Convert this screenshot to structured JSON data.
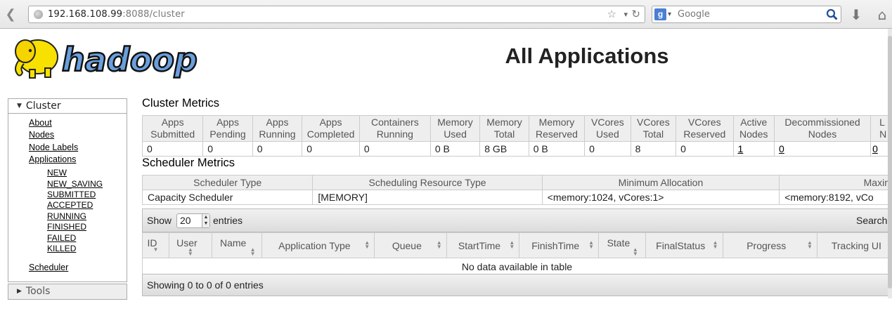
{
  "browser": {
    "url_host": "192.168.108.99",
    "url_path": ":8088/cluster",
    "search_placeholder": "Google",
    "search_engine_letter": "g"
  },
  "header": {
    "logo_text": "hadoop",
    "title": "All Applications"
  },
  "sidebar": {
    "cluster_label": "Cluster",
    "links": {
      "about": "About",
      "nodes": "Nodes",
      "node_labels": "Node Labels",
      "applications": "Applications",
      "scheduler": "Scheduler"
    },
    "app_states": {
      "new": "NEW",
      "new_saving": "NEW_SAVING",
      "submitted": "SUBMITTED",
      "accepted": "ACCEPTED",
      "running": "RUNNING",
      "finished": "FINISHED",
      "failed": "FAILED",
      "killed": "KILLED"
    },
    "tools_label": "Tools"
  },
  "cluster_metrics": {
    "title": "Cluster Metrics",
    "headers": {
      "apps_submitted": [
        "Apps",
        "Submitted"
      ],
      "apps_pending": [
        "Apps",
        "Pending"
      ],
      "apps_running": [
        "Apps",
        "Running"
      ],
      "apps_completed": [
        "Apps",
        "Completed"
      ],
      "containers_running": [
        "Containers",
        "Running"
      ],
      "memory_used": [
        "Memory",
        "Used"
      ],
      "memory_total": [
        "Memory",
        "Total"
      ],
      "memory_reserved": [
        "Memory",
        "Reserved"
      ],
      "vcores_used": [
        "VCores",
        "Used"
      ],
      "vcores_total": [
        "VCores",
        "Total"
      ],
      "vcores_reserved": [
        "VCores",
        "Reserved"
      ],
      "active_nodes": [
        "Active",
        "Nodes"
      ],
      "decommissioned_nodes": [
        "Decommissioned",
        "Nodes"
      ],
      "lost_nodes": [
        "L",
        "N"
      ]
    },
    "values": {
      "apps_submitted": "0",
      "apps_pending": "0",
      "apps_running": "0",
      "apps_completed": "0",
      "containers_running": "0",
      "memory_used": "0 B",
      "memory_total": "8 GB",
      "memory_reserved": "0 B",
      "vcores_used": "0",
      "vcores_total": "8",
      "vcores_reserved": "0",
      "active_nodes": "1",
      "decommissioned_nodes": "0",
      "lost_nodes": "0"
    }
  },
  "scheduler_metrics": {
    "title": "Scheduler Metrics",
    "headers": {
      "type": "Scheduler Type",
      "resource_type": "Scheduling Resource Type",
      "min_alloc": "Minimum Allocation",
      "max_alloc": "Maxin"
    },
    "values": {
      "type": "Capacity Scheduler",
      "resource_type": "[MEMORY]",
      "min_alloc": "<memory:1024, vCores:1>",
      "max_alloc": "<memory:8192, vCo"
    }
  },
  "apps_table": {
    "show_label": "Show",
    "page_size": "20",
    "entries_label": "entries",
    "search_label": "Search",
    "columns": {
      "id": "ID",
      "user": "User",
      "name": "Name",
      "app_type": "Application Type",
      "queue": "Queue",
      "start_time": "StartTime",
      "finish_time": "FinishTime",
      "state": "State",
      "final_status": "FinalStatus",
      "progress": "Progress",
      "tracking_ui": "Tracking UI"
    },
    "empty_message": "No data available in table",
    "info": "Showing 0 to 0 of 0 entries"
  }
}
